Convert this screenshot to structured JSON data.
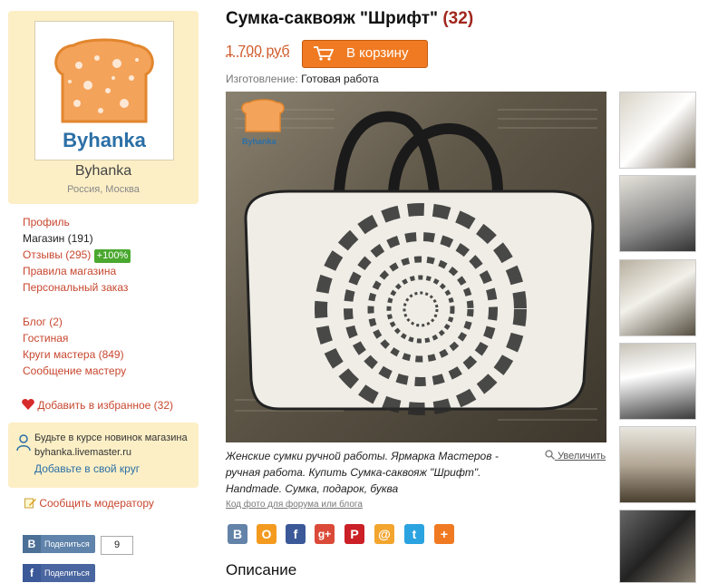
{
  "shop": {
    "logo_text": "Byhanka",
    "name": "Byhanka",
    "location": "Россия, Москва"
  },
  "menu1": {
    "profile": "Профиль",
    "store": "Магазин (191)",
    "reviews": "Отзывы (295)",
    "reviews_badge": "+100%",
    "rules": "Правила магазина",
    "custom_order": "Персональный заказ"
  },
  "menu2": {
    "blog": "Блог (2)",
    "lounge": "Гостиная",
    "circles": "Круги мастера (849)",
    "message": "Сообщение мастеру"
  },
  "favorites": "Добавить в избранное (32)",
  "news": {
    "line1": "Будьте в курсе новинок магазина",
    "line2": "byhanka.livemaster.ru",
    "link": "Добавьте в свой круг"
  },
  "report": "Сообщить модератору",
  "share": {
    "vk_label": "Поделиться",
    "vk_count": "9",
    "fb_label": "Поделиться"
  },
  "product": {
    "title": "Сумка-саквояж \"Шрифт\"",
    "count": "(32)",
    "price": "1 700 руб",
    "cart_label": "В корзину",
    "made_label": "Изготовление:",
    "made_value": "Готовая работа",
    "photo_watermark": "Byhanka",
    "caption": "Женские сумки ручной работы. Ярмарка Мастеров - ручная работа. Купить Сумка-саквояж \"Шрифт\". Handmade. Сумка, подарок, буква",
    "zoom_label": "Увеличить",
    "forum_link": "Код фото для форума или блога",
    "description_heading": "Описание"
  },
  "social_icons": [
    "vk-icon",
    "odnoklassniki-icon",
    "facebook-icon",
    "google-plus-icon",
    "pinterest-icon",
    "mail-icon",
    "twitter-icon",
    "plus-icon"
  ],
  "colors": {
    "accent_orange": "#f07a22",
    "link_red": "#c8472f",
    "card_bg": "#fcefc6",
    "logo_blue": "#2b6fa6"
  }
}
